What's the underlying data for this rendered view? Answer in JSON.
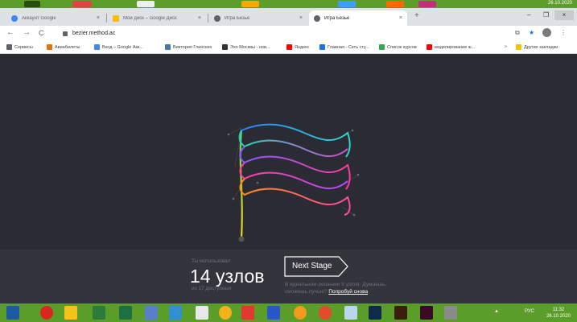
{
  "tabs": [
    {
      "title": "Аккаунт Google",
      "favicon": "google-icon",
      "color": "#4285f4",
      "active": false
    },
    {
      "title": "Мой диск – Google Диск",
      "favicon": "drive-icon",
      "color": "#fbbc05",
      "active": false
    },
    {
      "title": "Игра Безье",
      "favicon": "globe-icon",
      "color": "#5f6368",
      "active": false
    },
    {
      "title": "Игра Безье",
      "favicon": "globe-icon",
      "color": "#5f6368",
      "active": true
    }
  ],
  "new_tab": "+",
  "window": {
    "minimize": "–",
    "maximize": "❐",
    "close": "×"
  },
  "address": {
    "url": "bezier.method.ac",
    "back": "←",
    "forward": "→",
    "reload": "C",
    "star": "★",
    "menu": "⋮"
  },
  "bookmarks": [
    {
      "label": "Сервисы",
      "icon": "apps-icon",
      "color": "#5f6368"
    },
    {
      "label": "Авиабилеты",
      "icon": "plane-icon",
      "color": "#e37400"
    },
    {
      "label": "Вход – Google Акк...",
      "icon": "google-icon",
      "color": "#4285f4"
    },
    {
      "label": "Виктория Глинских",
      "icon": "vk-icon",
      "color": "#4a76a8"
    },
    {
      "label": "Эхо Москвы - нов...",
      "icon": "radio-icon",
      "color": "#333333"
    },
    {
      "label": "Яндекс",
      "icon": "yandex-icon",
      "color": "#ff0000"
    },
    {
      "label": "Главная - Сеть сту...",
      "icon": "network-icon",
      "color": "#1a73e8"
    },
    {
      "label": "Список курсов",
      "icon": "leaf-icon",
      "color": "#34a853"
    },
    {
      "label": "моделирование ж...",
      "icon": "yandex-icon",
      "color": "#ff0000"
    }
  ],
  "bookmarks_more": "»",
  "other_bookmarks": "Другие закладки",
  "game": {
    "used_label": "Ты использовал",
    "nodes_count": "14 узлов",
    "available": "из 17 доступных",
    "next_button": "Next Stage",
    "ideal_text": "В идеальном решении 9 узлов. Думаешь, сможешь лучше?",
    "retry_link": "Попробуй снова",
    "wave_colors": [
      "#3d8bff",
      "#22d7c9",
      "#a45cff",
      "#ff2d8f",
      "#ff8a1c"
    ],
    "pole_colors": [
      "#f2d320",
      "#46c75a"
    ]
  },
  "taskbar": {
    "lang": "РУС",
    "time": "11:32",
    "date": "26.10.2020"
  },
  "top_clock": "26.10.2020"
}
